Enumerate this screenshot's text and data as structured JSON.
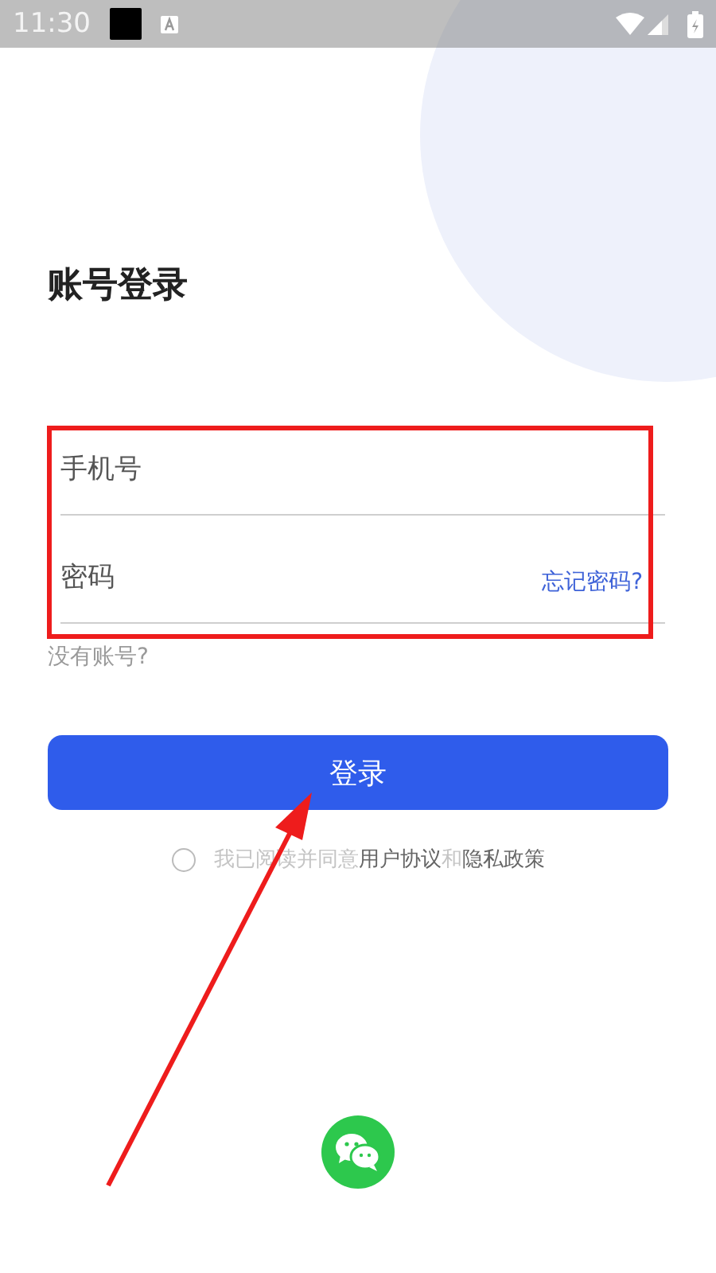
{
  "status_bar": {
    "time": "11:30"
  },
  "title": "账号登录",
  "phone_field": {
    "placeholder": "手机号"
  },
  "password_field": {
    "placeholder": "密码",
    "forgot_link": "忘记密码?"
  },
  "register_link": "没有账号?",
  "login_button": "登录",
  "agreement": {
    "checked": false,
    "prefix": "我已阅读并同意",
    "user_agreement": "用户协议",
    "joiner": "和",
    "privacy_policy": "隐私政策"
  }
}
